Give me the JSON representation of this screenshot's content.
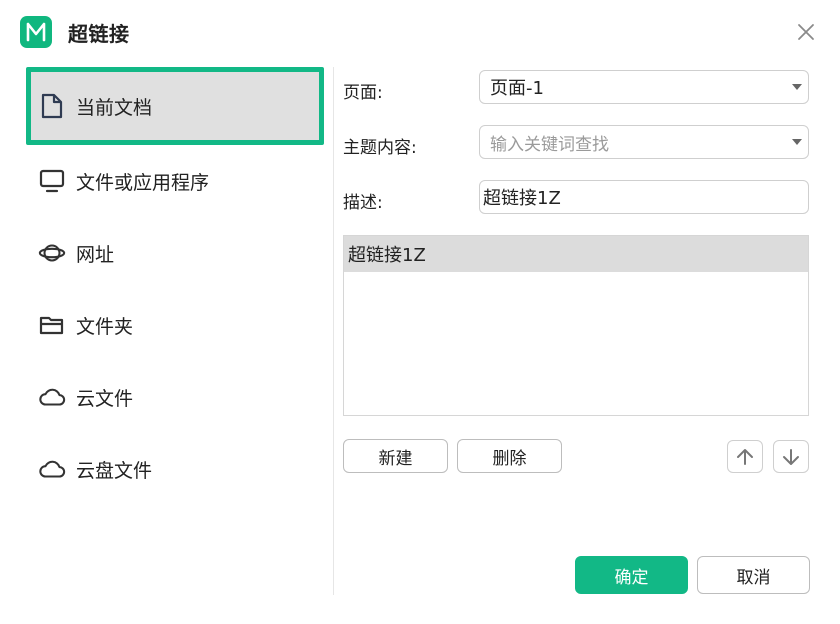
{
  "dialog": {
    "title": "超链接"
  },
  "sidebar": {
    "items": [
      {
        "label": "当前文档",
        "icon": "document-icon",
        "active": true
      },
      {
        "label": "文件或应用程序",
        "icon": "monitor-icon",
        "active": false
      },
      {
        "label": "网址",
        "icon": "planet-icon",
        "active": false
      },
      {
        "label": "文件夹",
        "icon": "folder-icon",
        "active": false
      },
      {
        "label": "云文件",
        "icon": "cloud-icon",
        "active": false
      },
      {
        "label": "云盘文件",
        "icon": "cloud-icon",
        "active": false
      }
    ]
  },
  "form": {
    "page_label": "页面:",
    "page_value": "页面-1",
    "topic_label": "主题内容:",
    "topic_placeholder": "输入关键词查找",
    "desc_label": "描述:",
    "desc_value": "超链接1Z"
  },
  "list": {
    "items": [
      "超链接1Z"
    ]
  },
  "buttons": {
    "new": "新建",
    "delete": "删除",
    "ok": "确定",
    "cancel": "取消"
  },
  "colors": {
    "accent": "#12b886",
    "active_bg": "#e0e0e0"
  }
}
